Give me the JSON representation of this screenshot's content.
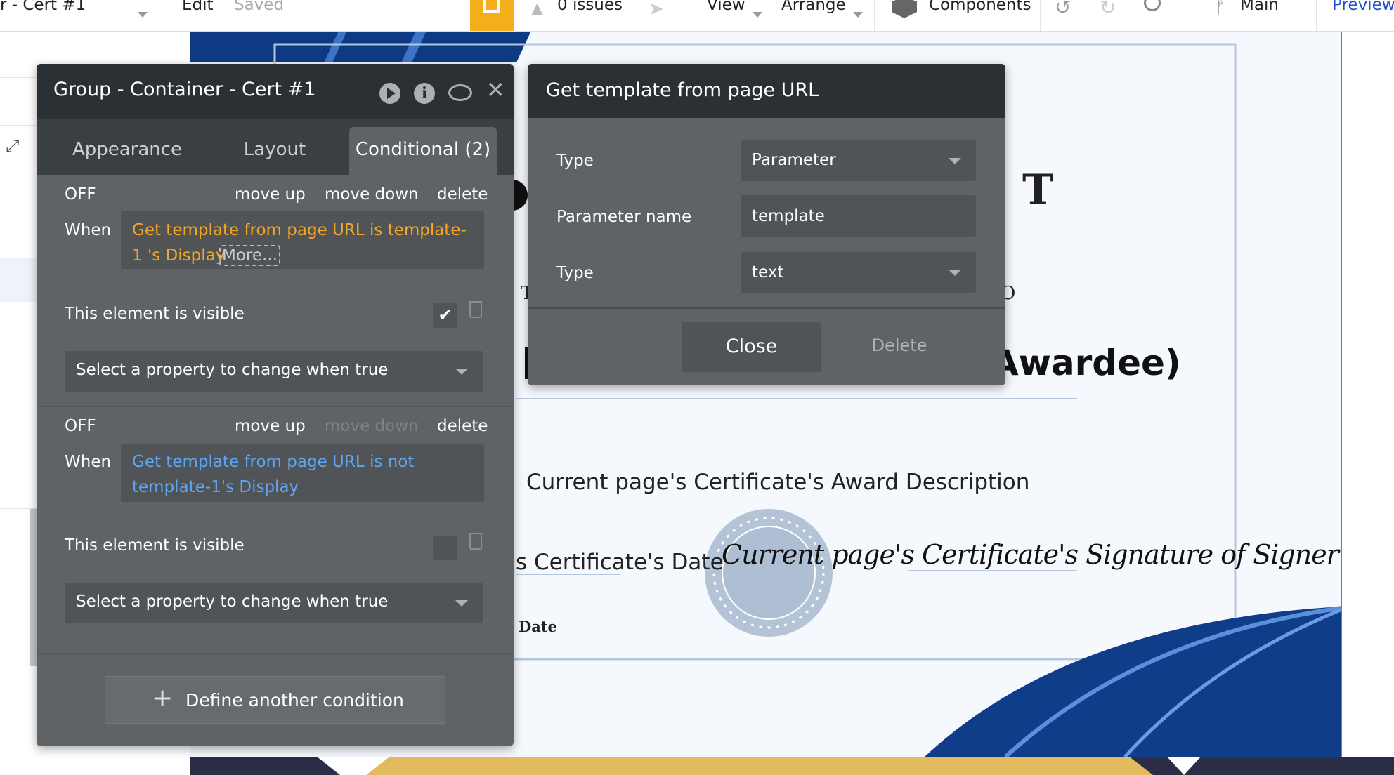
{
  "topbar": {
    "page_name": "r - Cert #1",
    "edit": "Edit",
    "saved": "Saved",
    "issues": "0 issues",
    "view": "View",
    "arrange": "Arrange",
    "components": "Components",
    "branch": "Main",
    "preview": "Preview",
    "accent": "#f5ad1b",
    "preview_color": "#1a4fd8"
  },
  "element_panel": {
    "title": "Group - Container - Cert #1",
    "icons": [
      "play-icon",
      "info-icon",
      "comment-icon",
      "close-icon"
    ],
    "tabs": [
      {
        "label": "Appearance",
        "active": false
      },
      {
        "label": "Layout",
        "active": false
      },
      {
        "label": "Conditional (2)",
        "active": true
      }
    ],
    "conditions": [
      {
        "status": "OFF",
        "move_up": "move up",
        "move_down": "move down",
        "delete": "delete",
        "when_label": "When",
        "expression_line1": "Get template from page URL  is template-",
        "expression_line2": "1 's Display",
        "more": "More...",
        "expression_color": "#f5a623",
        "property_label": "This element is visible",
        "checked": true,
        "select_placeholder": "Select a property to change when true"
      },
      {
        "status": "OFF",
        "move_up": "move up",
        "move_down": "move down",
        "delete": "delete",
        "when_label": "When",
        "expression_line1": "Get template from page URL is not",
        "expression_line2": "template-1's Display",
        "expression_color": "#5ea6f2",
        "property_label": "This element is visible",
        "checked": false,
        "select_placeholder": "Select a property to change when true"
      }
    ],
    "define_button": "Define another condition"
  },
  "dialog": {
    "title": "Get template from page URL",
    "rows": [
      {
        "label": "Type",
        "value": "Parameter",
        "kind": "dropdown"
      },
      {
        "label": "Parameter name",
        "value": "template",
        "kind": "input"
      },
      {
        "label": "Type",
        "value": "text",
        "kind": "dropdown"
      }
    ],
    "close": "Close",
    "delete": "Delete"
  },
  "certificate": {
    "letter_t_big": "T",
    "letter_t_small": "T",
    "letter_o": "O",
    "awardee": "Awardee)",
    "description": "Current page's Certificate's Award Description",
    "date_value": "s Certificate's Date",
    "date_label": "Date",
    "signature": "Current page's Certificate's Signature of Signer"
  }
}
